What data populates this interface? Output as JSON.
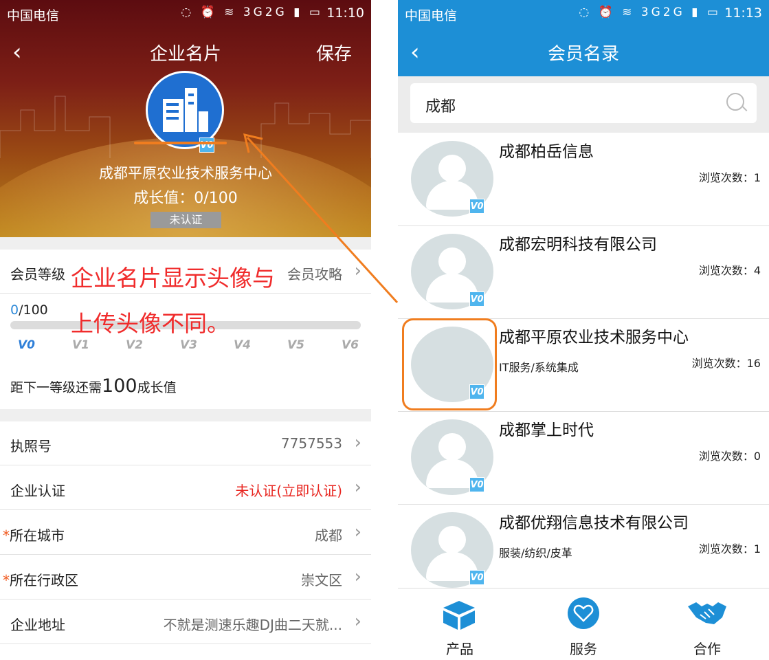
{
  "left": {
    "status": {
      "carrier": "中国电信",
      "icons": "◌ ⏰ ≋ 3G2G ▮ ▭",
      "time": "11:10"
    },
    "nav": {
      "back_glyph": "‹",
      "title": "企业名片",
      "action": "保存"
    },
    "profile": {
      "company_name": "成都平原农业技术服务中心",
      "growth_label": "成长值：0/100",
      "cert_tag": "未认证",
      "badge": "V0"
    },
    "level_row": {
      "label": "会员等级",
      "value": "会员攻略"
    },
    "progress": {
      "current": "0",
      "total": "/100",
      "fraction": 0
    },
    "levels": [
      "V0",
      "V1",
      "V2",
      "V3",
      "V4",
      "V5",
      "V6"
    ],
    "next_level": {
      "prefix": "距下一等级还需",
      "amount": "100",
      "suffix": "成长值"
    },
    "annotation": {
      "line1": "企业名片显示头像与",
      "line2": "上传头像不同。"
    },
    "rows": [
      {
        "label": "执照号",
        "value": "7757553",
        "required": false
      },
      {
        "label": "企业认证",
        "value": "未认证(立即认证)",
        "required": false,
        "value_color": "#e8251f"
      },
      {
        "label": "所在城市",
        "value": "成都",
        "required": true
      },
      {
        "label": "所在行政区",
        "value": "崇文区",
        "required": true
      },
      {
        "label": "企业地址",
        "value": "不就是测速乐趣DJ曲二天就...",
        "required": false
      }
    ],
    "required_mark": "*",
    "chevron": "›"
  },
  "right": {
    "status": {
      "carrier": "中国电信",
      "icons": "◌ ⏰ ≋ 3G2G ▮ ▭",
      "time": "11:13"
    },
    "nav": {
      "back_glyph": "‹",
      "title": "会员名录"
    },
    "search": {
      "value": "成都"
    },
    "members": [
      {
        "name": "成都柏岳信息",
        "category": "",
        "views": "浏览次数：1",
        "badge": "V0"
      },
      {
        "name": "成都宏明科技有限公司",
        "category": "",
        "views": "浏览次数：4",
        "badge": "V0"
      },
      {
        "name": "成都平原农业技术服务中心",
        "category": "IT服务/系统集成",
        "views": "浏览次数：16",
        "badge": "V0"
      },
      {
        "name": "成都掌上时代",
        "category": "",
        "views": "浏览次数：0",
        "badge": "V0"
      },
      {
        "name": "成都优翔信息技术有限公司",
        "category": "服装/纺织/皮革",
        "views": "浏览次数：1",
        "badge": "V0"
      }
    ],
    "tabs": [
      {
        "label": "产品",
        "icon": "box-icon"
      },
      {
        "label": "服务",
        "icon": "heart-icon"
      },
      {
        "label": "合作",
        "icon": "handshake-icon"
      }
    ]
  },
  "colors": {
    "left_header": "#7d1f16",
    "right_header": "#1d8fd6",
    "accent_orange": "#f07d1f",
    "annotation_red": "#f02b2b",
    "badge_blue": "#4fb5ee"
  }
}
